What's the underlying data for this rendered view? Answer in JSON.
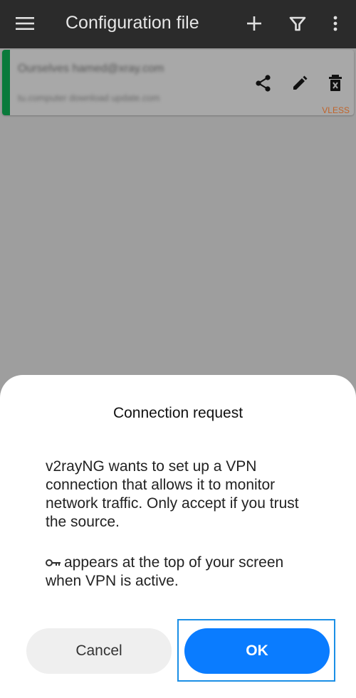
{
  "appbar": {
    "title": "Configuration file",
    "menu_icon": "menu-icon",
    "add_icon": "plus-icon",
    "filter_icon": "filter-icon",
    "more_icon": "more-vert-icon"
  },
  "server_card": {
    "remarks": "Ourselves hamed@xray.com",
    "address": "tu.computer download update.com",
    "type": "VLESS",
    "share_icon": "share-icon",
    "edit_icon": "edit-icon",
    "delete_icon": "delete-icon",
    "accent_color": "#0a7a3b"
  },
  "dialog": {
    "title": "Connection request",
    "message": "v2rayNG wants to set up a VPN connection that allows it to monitor network traffic. Only accept if you trust the source.",
    "note": "appears at the top of your screen when VPN is active.",
    "key_icon": "key-icon",
    "cancel_label": "Cancel",
    "ok_label": "OK",
    "accent_color": "#0a7cff"
  }
}
